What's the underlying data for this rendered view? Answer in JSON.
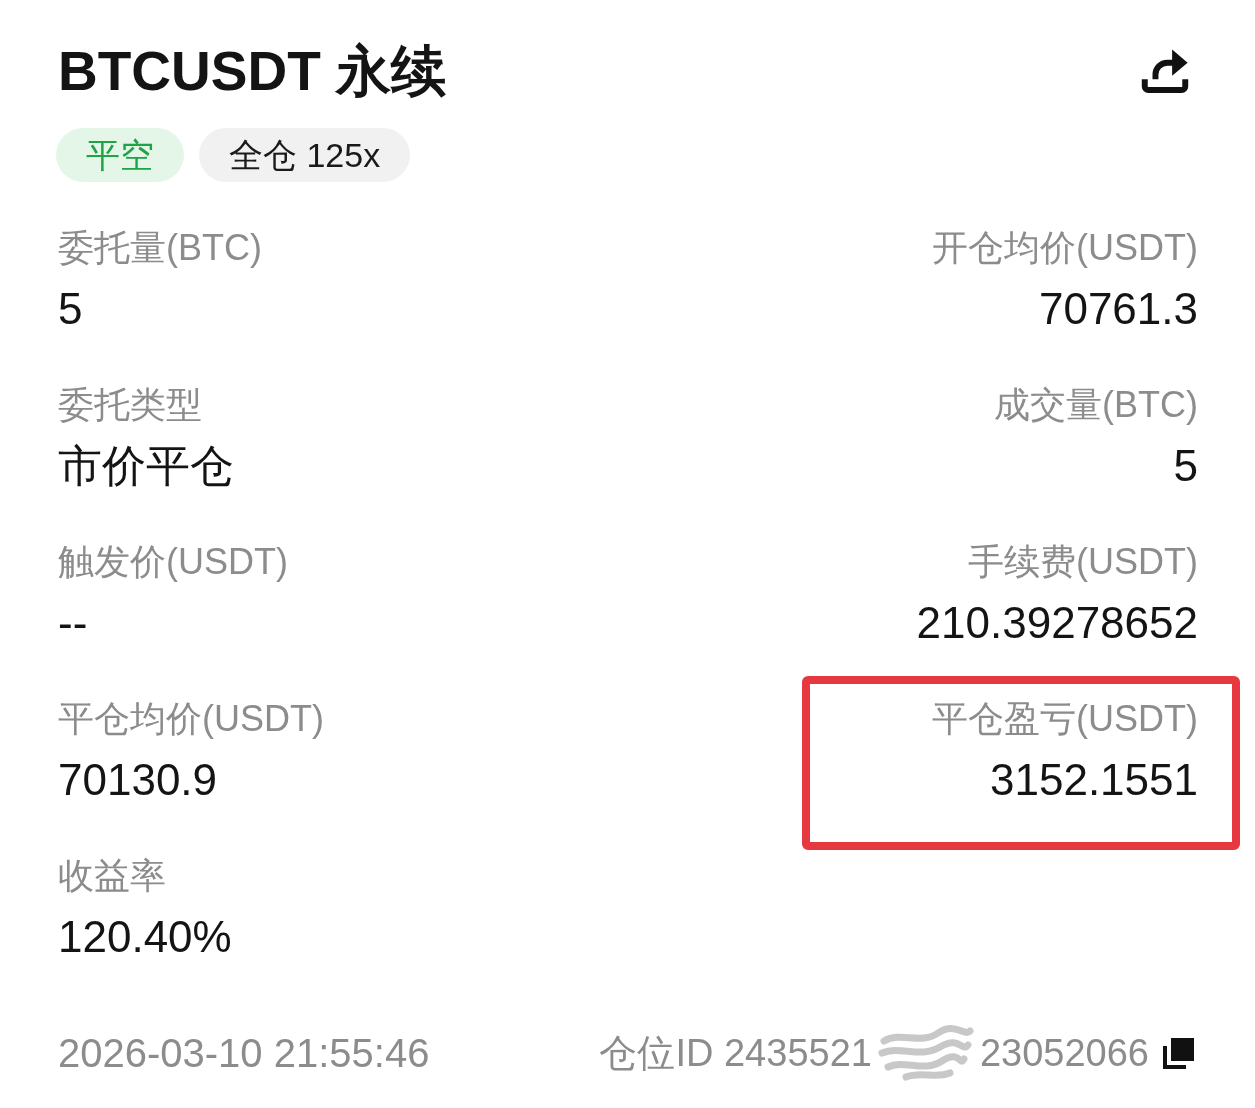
{
  "header": {
    "title": "BTCUSDT 永续"
  },
  "tags": [
    {
      "label": "平空",
      "kind": "side"
    },
    {
      "label": "全仓 125x",
      "kind": "margin"
    }
  ],
  "rows": [
    {
      "cells": [
        {
          "label": "委托量(BTC)",
          "value": "5",
          "highlighted": false
        },
        {
          "label": "开仓均价(USDT)",
          "value": "70761.3",
          "highlighted": false
        }
      ]
    },
    {
      "cells": [
        {
          "label": "委托类型",
          "value": "市价平仓",
          "highlighted": false
        },
        {
          "label": "成交量(BTC)",
          "value": "5",
          "highlighted": false
        }
      ]
    },
    {
      "cells": [
        {
          "label": "触发价(USDT)",
          "value": "--",
          "highlighted": false
        },
        {
          "label": "手续费(USDT)",
          "value": "210.39278652",
          "highlighted": false
        }
      ]
    },
    {
      "cells": [
        {
          "label": "平仓均价(USDT)",
          "value": "70130.9",
          "highlighted": false
        },
        {
          "label": "平仓盈亏(USDT)",
          "value": "3152.1551",
          "highlighted": true
        }
      ]
    },
    {
      "cells": [
        {
          "label": "收益率",
          "value": "120.40%",
          "highlighted": false
        }
      ]
    }
  ],
  "footer": {
    "time": "2026-03-10 21:55:46",
    "position_id": {
      "text_before": "仓位ID 2435521",
      "text_after": "23052066",
      "redacted": true
    }
  }
}
